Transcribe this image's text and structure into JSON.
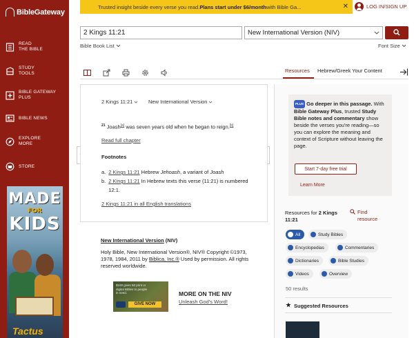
{
  "app": {
    "brand": "BibleGateway"
  },
  "sidebar": {
    "items": [
      {
        "label": "READ\nTHE BIBLE",
        "icon": "book-icon"
      },
      {
        "label": "STUDY\nTOOLS",
        "icon": "study-tools-icon"
      },
      {
        "label": "BIBLE GATEWAY\nPLUS",
        "icon": "plus-icon"
      },
      {
        "label": "BIBLE NEWS",
        "icon": "news-icon"
      },
      {
        "label": "EXPLORE\nMORE",
        "icon": "compass-icon"
      },
      {
        "label": "STORE",
        "icon": "store-icon"
      }
    ],
    "ad": {
      "line1": "MADE",
      "line2": "FOR",
      "line3": "KIDS",
      "brand": "Tactus"
    }
  },
  "topbar": {
    "text": "Trusted insight beside every verse you read. ",
    "bold": "Plans start under $6/month",
    "tail": " with Bible Ga...",
    "close": "✕"
  },
  "login": {
    "label": "LOG IN/SIGN UP"
  },
  "search": {
    "value": "2 Kings 11:21"
  },
  "version": {
    "selected": "New International Version (NIV)"
  },
  "links": {
    "book_list": "Bible Book List",
    "font_size": "Font Size"
  },
  "tabs": {
    "resources": "Resources",
    "hebrew_greek": "Hebrew/Greek Your Content"
  },
  "passage": {
    "ref": "2 Kings 11:21",
    "version": "New International Version",
    "verse_num": "21",
    "verse_pre": "Joash",
    "fn_a": "[a]",
    "verse_mid": " was seven years old when he began to reign.",
    "fn_b": "[b]",
    "read_full": "Read full chapter",
    "footnotes_heading": "Footnotes",
    "footnotes": [
      {
        "letter": "a.",
        "ref": "2 Kings 11:21",
        "text_pre": " Hebrew ",
        "text_it": "Jehoash",
        "text_post": ", a variant of ",
        "text_it2": "Joash"
      },
      {
        "letter": "b.",
        "ref": "2 Kings 11:21",
        "text": " In Hebrew texts this verse (11:21) is numbered 12:1."
      }
    ],
    "all_translations": "2 Kings 11:21 in all English translations"
  },
  "copyright": {
    "title_link": "New International Version",
    "title_abbr": " (NIV)",
    "text": "Holy Bible, New International Version®, NIV® Copyright ©1973, 1978, 1984, 2011 by ",
    "publisher": "Biblica, Inc.®",
    "text2": " Used by permission. All rights reserved worldwide."
  },
  "ad_bottom": {
    "text": "$100 gives 50 print or digital Bibles to people in need.",
    "button": "GIVE NOW"
  },
  "more_niv": {
    "title": "MORE ON THE NIV",
    "link": "Unleash God's Word!"
  },
  "promo": {
    "badge": "PLUS",
    "bold1": "Go deeper in this passage.",
    "text1": " With ",
    "bold2": "Bible Gateway Plus",
    "text2": ", trusted ",
    "bold3": "Study Bible notes and commentary",
    "text3": " show beside the verses you're reading—so you can explore the meaning and context of Scripture without leaving the page.",
    "trial": "Start 7-day free trial",
    "learn_more": "Learn More"
  },
  "resources": {
    "for_label": "Resources for ",
    "for_ref": "2 Kings 11:21",
    "find": "Find\nresource",
    "chips": [
      "All",
      "Study Bibles",
      "Encyclopedias",
      "Commentaries",
      "Dictionaries",
      "Bible Studies",
      "Videos",
      "Overview"
    ],
    "results": "50 results",
    "suggested": "Suggested Resources"
  }
}
